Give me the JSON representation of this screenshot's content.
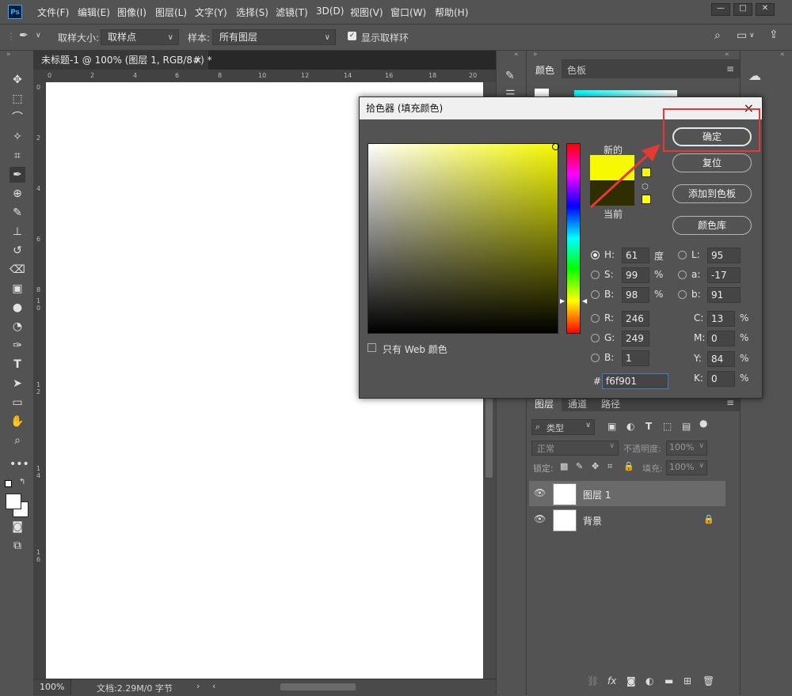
{
  "menubar": {
    "logo": "Ps",
    "items": [
      "文件(F)",
      "编辑(E)",
      "图像(I)",
      "图层(L)",
      "文字(Y)",
      "选择(S)",
      "滤镜(T)",
      "3D(D)",
      "视图(V)",
      "窗口(W)",
      "帮助(H)"
    ]
  },
  "options": {
    "sample_size_label": "取样大小:",
    "sample_size_value": "取样点",
    "sample_label": "样本:",
    "sample_value": "所有图层",
    "show_ring_label": "显示取样环"
  },
  "document": {
    "tab_title": "未标题-1 @ 100% (图层 1, RGB/8#) *",
    "tab_close": "×",
    "ruler_h": [
      "0",
      "2",
      "4",
      "6",
      "8",
      "10",
      "12",
      "14",
      "16",
      "18",
      "20"
    ],
    "ruler_v": [
      "0",
      "2",
      "4",
      "6",
      "8",
      "1\n0",
      "1\n2",
      "1\n4",
      "1\n6"
    ],
    "zoom": "100%",
    "doc_info": "文档:2.29M/0 字节"
  },
  "panels": {
    "color_tabs": [
      "颜色",
      "色板"
    ],
    "layer_tabs": [
      "图层",
      "通道",
      "路径"
    ],
    "filter_kind": "类型",
    "blend_mode": "正常",
    "opacity_label": "不透明度:",
    "opacity_value": "100%",
    "lock_label": "锁定:",
    "fill_label": "填充:",
    "fill_value": "100%",
    "layers": [
      {
        "name": "图层 1"
      },
      {
        "name": "背景"
      }
    ]
  },
  "picker": {
    "title": "拾色器 (填充颜色)",
    "close": "×",
    "new_label": "新的",
    "current_label": "当前",
    "new_color": "#f6f901",
    "current_color": "#2e2e00",
    "web_only_label": "只有 Web 颜色",
    "buttons": {
      "ok": "确定",
      "reset": "复位",
      "add_swatch": "添加到色板",
      "libraries": "颜色库"
    },
    "hsb": {
      "H": "61",
      "S": "99",
      "B": "98",
      "H_unit": "度",
      "S_unit": "%",
      "B_unit": "%"
    },
    "lab": {
      "L": "95",
      "a": "-17",
      "b": "91"
    },
    "rgb": {
      "R": "246",
      "G": "249",
      "B": "1"
    },
    "cmyk": {
      "C": "13",
      "M": "0",
      "Y": "84",
      "K": "0",
      "unit": "%"
    },
    "hex_label": "#",
    "hex": "f6f901"
  }
}
